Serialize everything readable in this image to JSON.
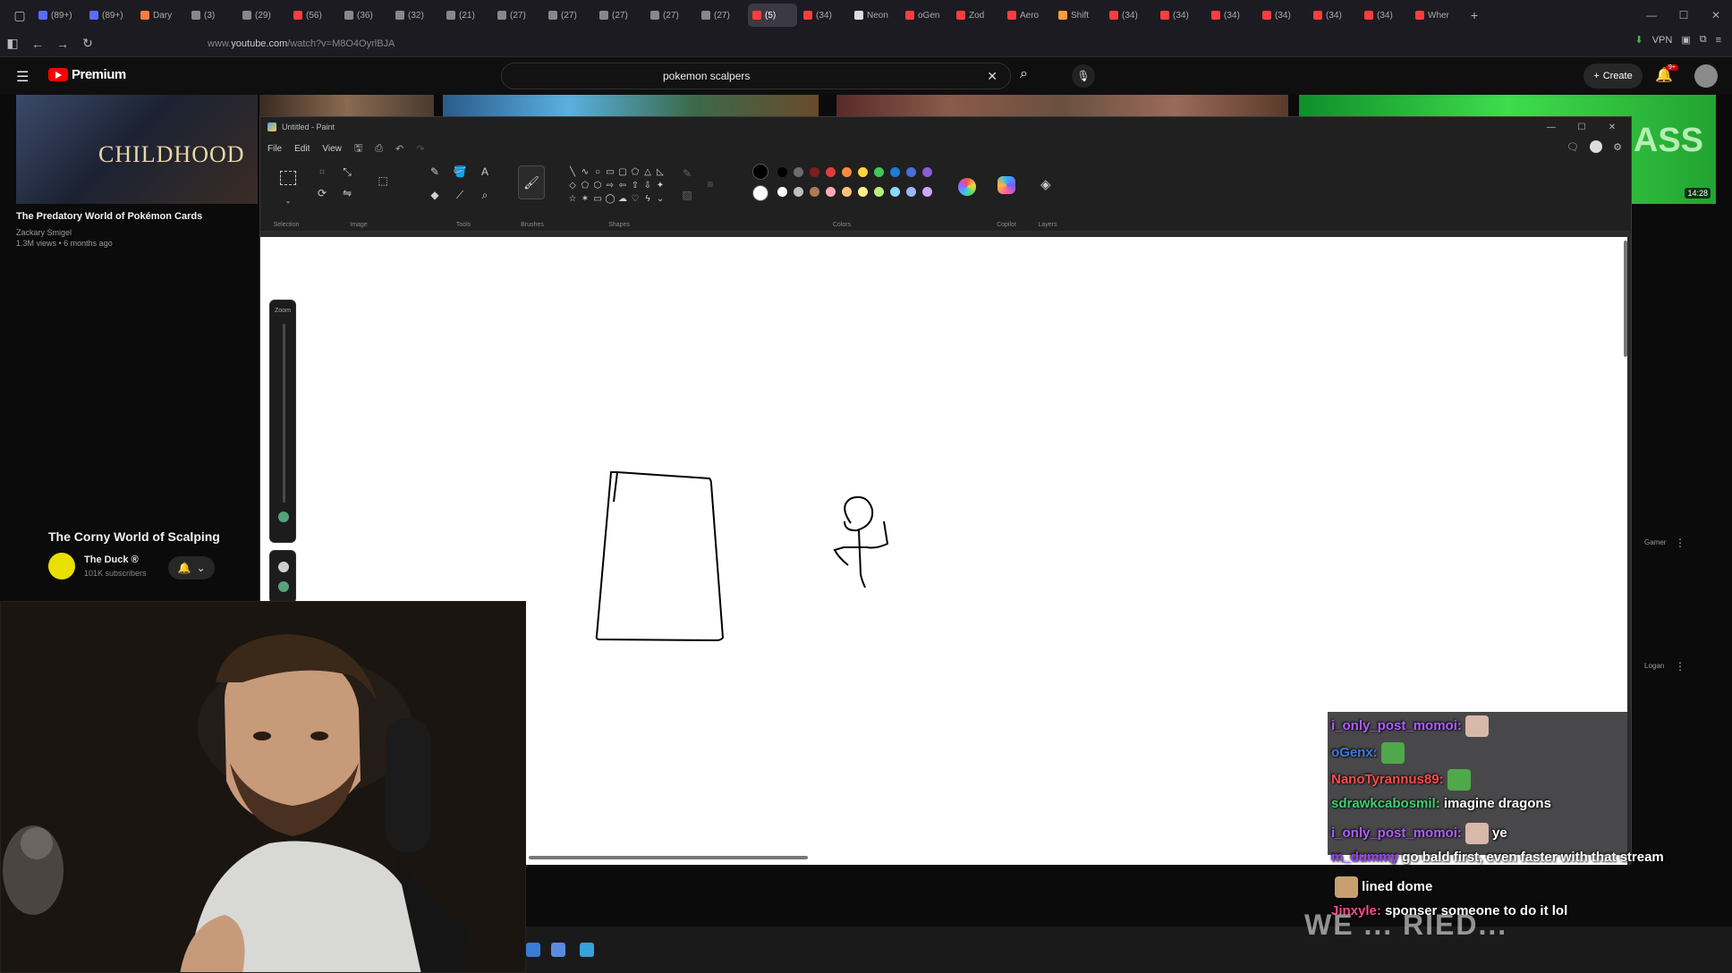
{
  "browser": {
    "tabs": [
      {
        "label": "(89+)",
        "color": "#5b6cff"
      },
      {
        "label": "(89+)",
        "color": "#5b6cff"
      },
      {
        "label": "Dary",
        "color": "#ff7b3a"
      },
      {
        "label": "(3)",
        "color": "#888"
      },
      {
        "label": "(29)",
        "color": "#888"
      },
      {
        "label": "(56)",
        "color": "#ff3d3d"
      },
      {
        "label": "(36)",
        "color": "#888"
      },
      {
        "label": "(32)",
        "color": "#888"
      },
      {
        "label": "(21)",
        "color": "#888"
      },
      {
        "label": "(27)",
        "color": "#888"
      },
      {
        "label": "(27)",
        "color": "#888"
      },
      {
        "label": "(27)",
        "color": "#888"
      },
      {
        "label": "(27)",
        "color": "#888"
      },
      {
        "label": "(27)",
        "color": "#888"
      },
      {
        "label": "(5)",
        "color": "#ff3d3d"
      },
      {
        "label": "(34)",
        "color": "#ff3d3d"
      },
      {
        "label": "Neon",
        "color": "#ddd"
      },
      {
        "label": "oGen",
        "color": "#ff3d3d"
      },
      {
        "label": "Zod",
        "color": "#ff3d3d"
      },
      {
        "label": "Aero",
        "color": "#ff3d3d"
      },
      {
        "label": "Shift",
        "color": "#ff9d3d"
      },
      {
        "label": "(34)",
        "color": "#ff3d3d"
      },
      {
        "label": "(34)",
        "color": "#ff3d3d"
      },
      {
        "label": "(34)",
        "color": "#ff3d3d"
      },
      {
        "label": "(34)",
        "color": "#ff3d3d"
      },
      {
        "label": "(34)",
        "color": "#ff3d3d"
      },
      {
        "label": "(34)",
        "color": "#ff3d3d"
      },
      {
        "label": "Wher",
        "color": "#ff3d3d"
      }
    ],
    "active_tab_index": 14,
    "url_prefix": "www.",
    "url_domain": "youtube.com",
    "url_path": "/watch?v=M8O4OyrlBJA",
    "vpn_label": "VPN"
  },
  "youtube": {
    "brand": "Premium",
    "search_value": "pokemon scalpers",
    "create_label": "Create",
    "notif_count": "9+",
    "side_video": {
      "thumb_text": "CHILDHOOD",
      "title": "The Predatory World of Pokémon Cards",
      "channel": "Zackary Smigel",
      "meta": "1.3M views • 6 months ago"
    },
    "right_video": {
      "thumb_text": "ASS",
      "duration": "14:28"
    },
    "right_labels": [
      "Gamer",
      "Logan"
    ],
    "main_title": "The Corny World of Scalping",
    "channel_name": "The Duck ®",
    "channel_subs": "101K subscribers"
  },
  "paint": {
    "window_title": "Untitled - Paint",
    "menu": [
      "File",
      "Edit",
      "View"
    ],
    "groups": [
      "Selection",
      "Image",
      "Tools",
      "Brushes",
      "Shapes",
      "Colors",
      "Copilot",
      "Layers"
    ],
    "colors_row1": [
      "#000000",
      "#6b6b6b",
      "#7b1f1f",
      "#e03c3c",
      "#ff8a3d",
      "#ffd43b",
      "#3ec95a",
      "#1e7bd8",
      "#4a6ed8",
      "#8a5cd8"
    ],
    "colors_row2": [
      "#ffffff",
      "#bfbfbf",
      "#b07a5a",
      "#ffa9b8",
      "#ffc27a",
      "#fff18a",
      "#b8f07a",
      "#8ad8ff",
      "#9ab8ff",
      "#c8a8ff"
    ],
    "primary_color": "#000000",
    "secondary_color": "#ffffff",
    "zoom_label": "Zoom"
  },
  "chat": [
    {
      "user": "i_only_post_momoi:",
      "color": "#b25cff",
      "msg": "",
      "emote": "#d8b8a8"
    },
    {
      "user": "oGenx:",
      "color": "#3d7bd8",
      "msg": "",
      "emote": "#4fa84a"
    },
    {
      "user": "NanoTyrannus89:",
      "color": "#ff4a4a",
      "msg": "",
      "emote": "#4fa84a"
    },
    {
      "user": "sdrawkcabosmil:",
      "color": "#3ed070",
      "msg": "imagine dragons",
      "emote": ""
    },
    {
      "user": "i_only_post_momoi:",
      "color": "#b25cff",
      "msg": "ye",
      "emote": "#d8b8a8"
    },
    {
      "user": "m_dummy",
      "color": "#9b3dff",
      "msg": "go bald first, even faster with that stream",
      "emote": ""
    },
    {
      "user": "",
      "color": "#ffffff",
      "msg": "lined dome",
      "emote": "#c8a070"
    },
    {
      "user": "Jinxyle:",
      "color": "#ff4a8a",
      "msg": "sponser someone to do it lol",
      "emote": ""
    }
  ],
  "overlay_text": "WE ... RIED..."
}
